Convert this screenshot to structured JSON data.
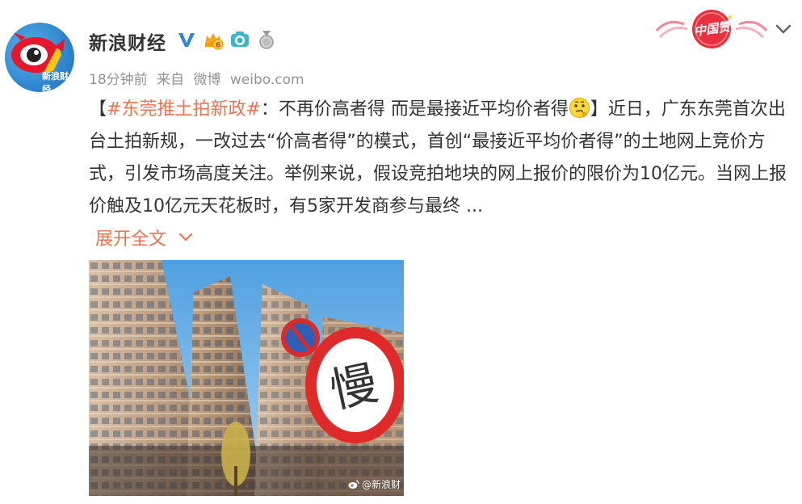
{
  "user": {
    "name": "新浪财经",
    "avatar_brand_text": "新浪财经",
    "badges": [
      "verified-v-icon",
      "level-6-icon",
      "camera-icon",
      "medal-icon"
    ]
  },
  "meta": {
    "time": "18分钟前",
    "source_prefix": "来自",
    "source_app": "微博",
    "source_site": "weibo.com"
  },
  "campaign": {
    "text": "中国赞"
  },
  "post": {
    "bracket_open": "【",
    "topic": "#东莞推土拍新政#",
    "headline": "：不再价高者得 而是最接近平均价者得",
    "bracket_close": "】",
    "body": "近日，广东东莞首次出台土拍新规，一改过去“价高者得”的模式，首创“最接近平均价者得”的土地网上竞价方式，引发市场高度关注。举例来说，假设竞拍地块的网上报价的限价为10亿元。当网上报价触及10亿元天花板时，有5家开发商参与最终 ...",
    "expand_label": "展开全文"
  },
  "image": {
    "sign_text": "慢",
    "watermark": "@新浪财"
  },
  "colors": {
    "accent": "#eb7350",
    "meta": "#939393",
    "text": "#333333",
    "verified": "#f7b500"
  }
}
